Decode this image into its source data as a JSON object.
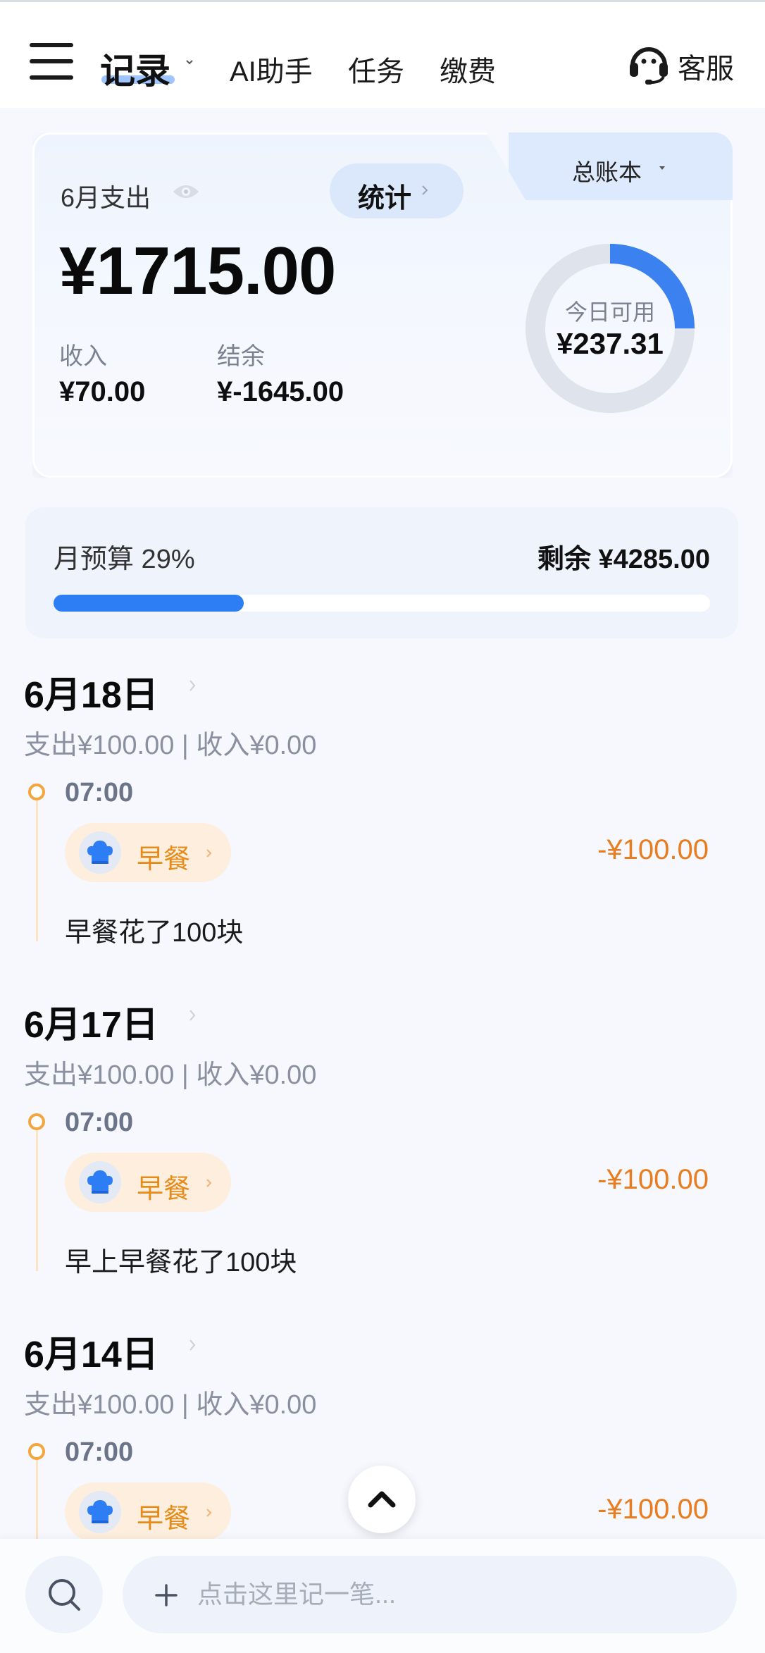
{
  "header": {
    "title": "记录",
    "nav": [
      "AI助手",
      "任务",
      "缴费"
    ],
    "service_label": "客服"
  },
  "summary": {
    "ledger_label": "总账本",
    "month_expense_label": "6月支出",
    "stat_label": "统计",
    "expense_amount": "¥1715.00",
    "income_label": "收入",
    "income_value": "¥70.00",
    "balance_label": "结余",
    "balance_value": "¥-1645.00",
    "today_label": "今日可用",
    "today_value": "¥237.31",
    "today_ratio": 0.25,
    "ring_color": "#3b82f0",
    "track_color": "#dfe4ec"
  },
  "budget": {
    "label": "月预算 29%",
    "remaining": "剩余 ¥4285.00",
    "percent": 29,
    "fill_color": "#2d7ef5"
  },
  "days": [
    {
      "date": "6月18日",
      "summary": "支出¥100.00 | 收入¥0.00",
      "time": "07:00",
      "category": "早餐",
      "amount": "-¥100.00",
      "note": "早餐花了100块"
    },
    {
      "date": "6月17日",
      "summary": "支出¥100.00 | 收入¥0.00",
      "time": "07:00",
      "category": "早餐",
      "amount": "-¥100.00",
      "note": "早上早餐花了100块"
    },
    {
      "date": "6月14日",
      "summary": "支出¥100.00 | 收入¥0.00",
      "time": "07:00",
      "category": "早餐",
      "amount": "-¥100.00",
      "note": ""
    }
  ],
  "bottom": {
    "placeholder": "点击这里记一笔..."
  }
}
